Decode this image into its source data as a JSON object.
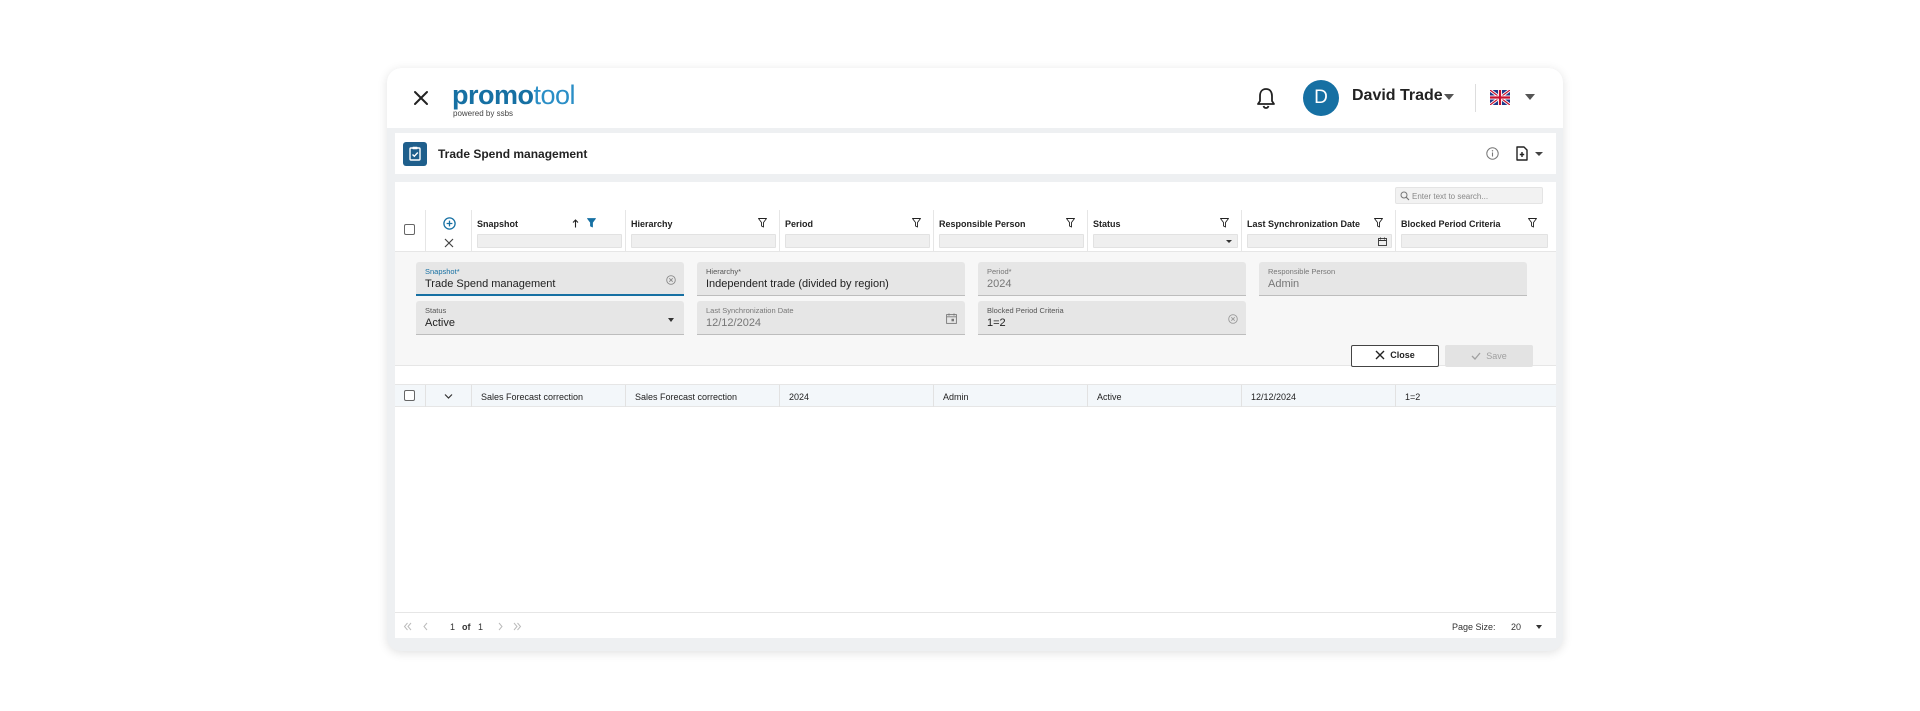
{
  "app": {
    "logo_bold": "promo",
    "logo_light": "tool",
    "logo_subtitle": "powered by ssbs"
  },
  "user": {
    "initial": "D",
    "name": "David Trade",
    "language_flag": "uk-flag-icon"
  },
  "page": {
    "title": "Trade Spend management"
  },
  "search": {
    "placeholder": "Enter text to search..."
  },
  "columns": [
    {
      "label": "Snapshot",
      "sorted": "ascending",
      "filter_active": true
    },
    {
      "label": "Hierarchy"
    },
    {
      "label": "Period"
    },
    {
      "label": "Responsible Person"
    },
    {
      "label": "Status"
    },
    {
      "label": "Last Synchronization Date"
    },
    {
      "label": "Blocked Period Criteria"
    }
  ],
  "form": {
    "snapshot": {
      "label": "Snapshot*",
      "value": "Trade Spend management"
    },
    "hierarchy": {
      "label": "Hierarchy*",
      "value": "Independent trade (divided by region)"
    },
    "period": {
      "label": "Period*",
      "value": "2024"
    },
    "responsible": {
      "label": "Responsible Person",
      "value": "Admin"
    },
    "status": {
      "label": "Status",
      "value": "Active"
    },
    "last_sync": {
      "label": "Last Synchronization Date",
      "value": "12/12/2024"
    },
    "blocked": {
      "label": "Blocked Period Criteria",
      "value": "1=2"
    },
    "close_label": "Close",
    "save_label": "Save"
  },
  "rows": [
    {
      "snapshot": "Sales Forecast correction",
      "hierarchy": "Sales Forecast correction",
      "period": "2024",
      "responsible": "Admin",
      "status": "Active",
      "last_sync": "12/12/2024",
      "blocked": "1=2"
    }
  ],
  "pager": {
    "current": "1",
    "of_label": "of",
    "total": "1",
    "page_size_label": "Page Size:",
    "page_size": "20"
  },
  "colors": {
    "brand": "#1670a3",
    "title_icon": "#1f5f8c",
    "row_highlight": "#f3f7fa"
  }
}
